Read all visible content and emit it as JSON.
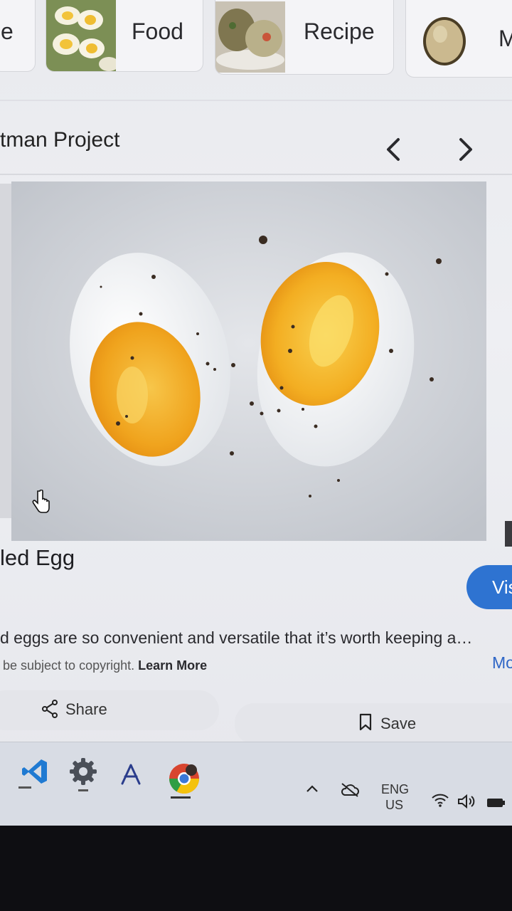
{
  "chips": [
    {
      "label": "e"
    },
    {
      "label": "Food"
    },
    {
      "label": "Recipe"
    },
    {
      "label": "M"
    }
  ],
  "topic": {
    "title": "tman Project"
  },
  "image": {
    "title": "led Egg",
    "description": "d eggs are so convenient and versatile that it’s worth keeping a…",
    "more_label": "Mo",
    "copyright_text": "be subject to copyright.",
    "learn_more_label": "Learn More",
    "visit_label": "Vis"
  },
  "actions": {
    "share_label": "Share",
    "save_label": "Save"
  },
  "taskbar": {
    "language": "ENG",
    "region": "US"
  },
  "colors": {
    "accent": "#2e73d1",
    "yolk": "#f0a41e",
    "background": "#eeeff3"
  }
}
